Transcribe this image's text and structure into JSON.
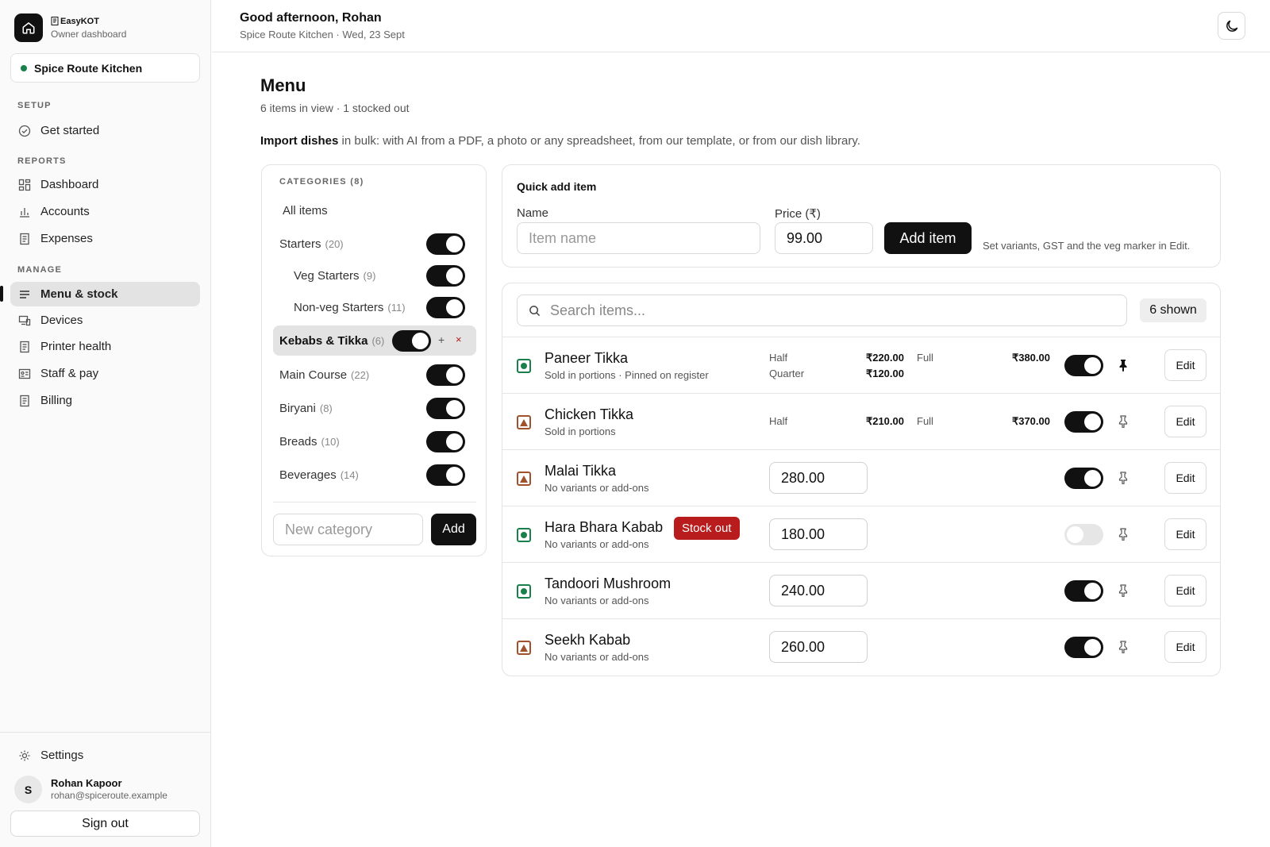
{
  "brand": {
    "name": "EasyKOT",
    "subtitle": "Owner dashboard"
  },
  "kitchen": {
    "name": "Spice Route Kitchen",
    "status_color": "#1a7f4b"
  },
  "nav": {
    "setup_label": "SETUP",
    "setup": [
      {
        "label": "Get started",
        "icon": "check-circle-icon"
      }
    ],
    "reports_label": "REPORTS",
    "reports": [
      {
        "label": "Dashboard",
        "icon": "grid-icon"
      },
      {
        "label": "Accounts",
        "icon": "bar-chart-icon"
      },
      {
        "label": "Expenses",
        "icon": "receipt-icon"
      }
    ],
    "manage_label": "MANAGE",
    "manage": [
      {
        "label": "Menu & stock",
        "icon": "list-icon",
        "active": true
      },
      {
        "label": "Devices",
        "icon": "devices-icon"
      },
      {
        "label": "Printer health",
        "icon": "receipt-icon"
      },
      {
        "label": "Staff & pay",
        "icon": "id-card-icon"
      },
      {
        "label": "Billing",
        "icon": "receipt-icon"
      }
    ],
    "settings": "Settings"
  },
  "user": {
    "initial": "S",
    "name": "Rohan Kapoor",
    "email": "rohan@spiceroute.example",
    "signout": "Sign out"
  },
  "header": {
    "greeting": "Good afternoon, Rohan",
    "subtitle": "Spice Route Kitchen · Wed, 23 Sept"
  },
  "page": {
    "title": "Menu",
    "subtitle": "6 items in view · 1 stocked out",
    "import_bold": "Import dishes",
    "import_rest": " in bulk: with AI from a PDF, a photo or any spreadsheet, from our template, or from our dish library."
  },
  "categories": {
    "title": "CATEGORIES (8)",
    "all_label": "All items",
    "items": [
      {
        "name": "Starters",
        "count": "(20)",
        "enabled": true
      },
      {
        "name": "Veg Starters",
        "count": "(9)",
        "enabled": true,
        "sub": true
      },
      {
        "name": "Non-veg Starters",
        "count": "(11)",
        "enabled": true,
        "sub": true
      },
      {
        "name": "Kebabs & Tikka",
        "count": "(6)",
        "enabled": true,
        "selected": true
      },
      {
        "name": "Main Course",
        "count": "(22)",
        "enabled": true
      },
      {
        "name": "Biryani",
        "count": "(8)",
        "enabled": true
      },
      {
        "name": "Breads",
        "count": "(10)",
        "enabled": true
      },
      {
        "name": "Beverages",
        "count": "(14)",
        "enabled": true
      }
    ],
    "new_placeholder": "New category",
    "add_label": "Add"
  },
  "quick_add": {
    "title": "Quick add item",
    "name_label": "Name",
    "name_placeholder": "Item name",
    "price_label": "Price (₹)",
    "price_value": "99.00",
    "add_label": "Add item",
    "hint": "Set variants, GST and the veg marker in Edit."
  },
  "items_list": {
    "search_placeholder": "Search items...",
    "shown": "6 shown",
    "edit_label": "Edit",
    "items": [
      {
        "name": "Paneer Tikka",
        "sub": "Sold in portions · Pinned on register",
        "type": "veg",
        "in_stock": true,
        "pinned": true,
        "variants": [
          {
            "label": "Half",
            "price": "₹220.00"
          },
          {
            "label": "Quarter",
            "price": "₹120.00"
          },
          {
            "label": "Full",
            "price": "₹380.00"
          }
        ]
      },
      {
        "name": "Chicken Tikka",
        "sub": "Sold in portions",
        "type": "nonveg",
        "in_stock": true,
        "pinned": false,
        "variants": [
          {
            "label": "Half",
            "price": "₹210.00"
          },
          {
            "label": "Full",
            "price": "₹370.00"
          }
        ]
      },
      {
        "name": "Malai Tikka",
        "sub": "No variants or add-ons",
        "type": "nonveg",
        "in_stock": true,
        "pinned": false,
        "price": "280.00"
      },
      {
        "name": "Hara Bhara Kabab",
        "sub": "No variants or add-ons",
        "type": "veg",
        "in_stock": false,
        "pinned": false,
        "price": "180.00",
        "badge": "Stock out"
      },
      {
        "name": "Tandoori Mushroom",
        "sub": "No variants or add-ons",
        "type": "veg",
        "in_stock": true,
        "pinned": false,
        "price": "240.00"
      },
      {
        "name": "Seekh Kabab",
        "sub": "No variants or add-ons",
        "type": "nonveg",
        "in_stock": true,
        "pinned": false,
        "price": "260.00"
      }
    ]
  },
  "colors": {
    "accent": "#111111",
    "veg": "#1a7f4b",
    "nonveg": "#a0522d",
    "stock_out": "#b91c1c"
  }
}
